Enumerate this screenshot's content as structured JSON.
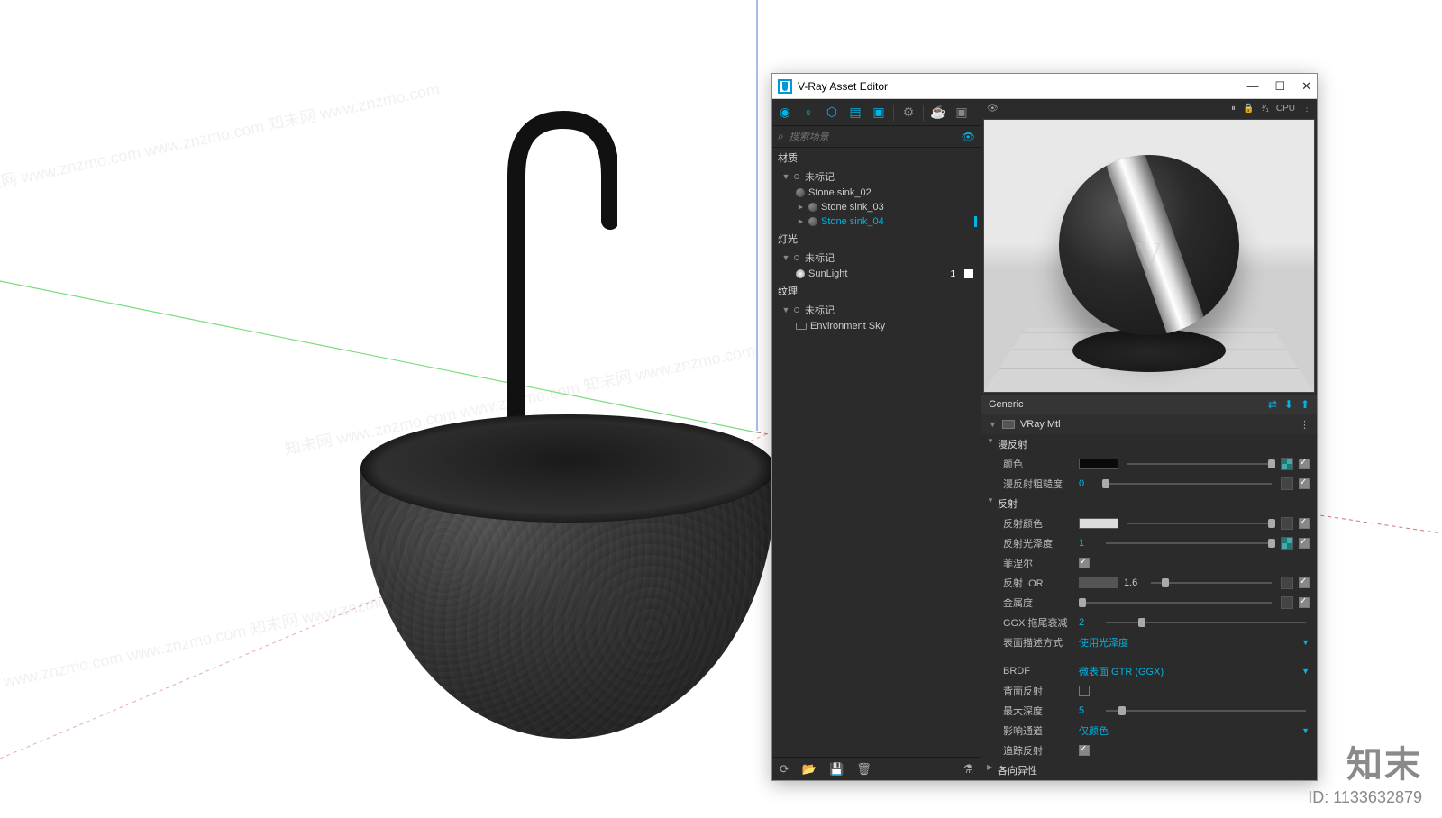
{
  "window": {
    "title": "V-Ray Asset Editor"
  },
  "search": {
    "placeholder": "搜索场景"
  },
  "tree": {
    "materials_header": "材质",
    "untagged": "未标记",
    "m1": "Stone sink_02",
    "m2": "Stone sink_03",
    "m3": "Stone sink_04",
    "lights_header": "灯光",
    "sun": "SunLight",
    "sun_count": "1",
    "tex_header": "纹理",
    "env": "Environment Sky"
  },
  "generic": {
    "label": "Generic"
  },
  "vraymtl": {
    "label": "VRay Mtl"
  },
  "preview": {
    "cpu": "CPU",
    "frac": "¹⁄₁"
  },
  "sections": {
    "diffuse": "漫反射",
    "reflect": "反射",
    "aniso": "各向异性"
  },
  "props": {
    "color": "颜色",
    "diffuse_rough": "漫反射粗糙度",
    "diffuse_rough_v": "0",
    "reflect_color": "反射颜色",
    "reflect_gloss": "反射光泽度",
    "reflect_gloss_v": "1",
    "fresnel": "菲涅尔",
    "reflect_ior": "反射 IOR",
    "reflect_ior_v": "1.6",
    "metalness": "金属度",
    "ggx_tail": "GGX 拖尾衰减",
    "ggx_tail_v": "2",
    "surface_mode": "表面描述方式",
    "surface_mode_v": "使用光泽度",
    "brdf": "BRDF",
    "brdf_v": "微表面 GTR (GGX)",
    "backside": "背面反射",
    "max_depth": "最大深度",
    "max_depth_v": "5",
    "affect": "影响通道",
    "affect_v": "仅颜色",
    "trace": "追踪反射"
  },
  "brand": {
    "name": "知末",
    "id": "ID: 1133632879"
  },
  "wm": "知末网 www.znzmo.com  www.znzmo.com  知末网 www.znzmo.com"
}
